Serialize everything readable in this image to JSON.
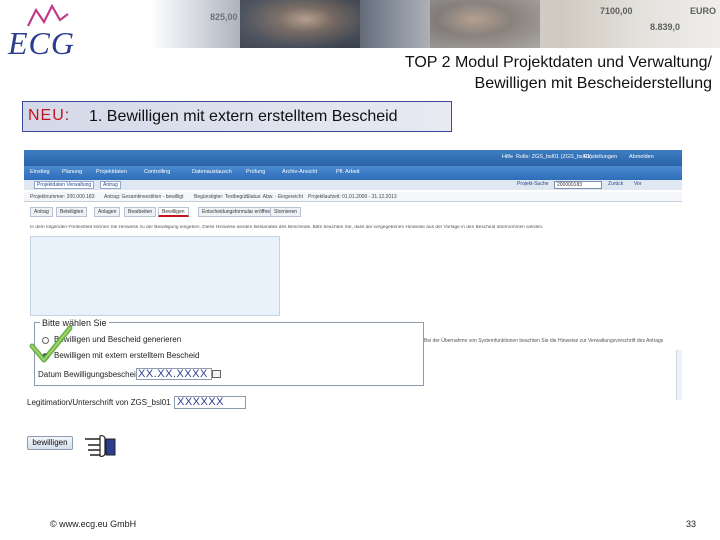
{
  "slide": {
    "title_line1": "TOP 2 Modul Projektdaten und Verwaltung/",
    "title_line2": "Bewilligen mit Bescheiderstellung",
    "neu_label": "NEU:",
    "neu_text": "1. Bewilligen mit extern erstelltem Bescheid",
    "footer_copyright": "© www.ecg.eu GmbH",
    "page_number": "33"
  },
  "logo": {
    "text": "ECG",
    "color": "#2a3d8f"
  },
  "banner": {
    "notes": [
      "825,00",
      "7100,00",
      "8.839,0",
      "EURO"
    ]
  },
  "app": {
    "nav_items": [
      "Einstieg",
      "Planung",
      "Projektdaten",
      "Controlling",
      "Datenaustausch",
      "Prüfung",
      "Archiv-Ansicht",
      "Pfl. Arbeit"
    ],
    "user_area": [
      "Hilfe",
      "Rolle: ZGS_bsl01 (ZGS_bsl01)",
      "Einstellungen",
      "Abmelden"
    ],
    "crumbs": [
      "Projektdaten Verwaltung",
      "Antrag"
    ],
    "search_label": "Projekt-Suche",
    "search_value": "200000183",
    "back_link": "Zurück",
    "forward_link": "Vor",
    "info_items": [
      "Projektnummer: 200.000.183",
      "Antrag: Gesamtinvestition - bewilligt",
      "Begünstigter: Testbegün",
      "Status: Abw. - Eingereicht",
      "Projektlaufzeit: 01.01.2009 - 31.12.2013"
    ],
    "tabs": [
      "Antrag",
      "Beteiligten",
      "Anlagen",
      "Bearbeiten",
      "Bewilligen",
      "Entscheidungsformular eröffnen",
      "Stornieren"
    ],
    "active_tab_index": 4,
    "description": "In dem folgenden Freitextfeld können Sie Hinweise zu der Bewilligung eingeben. Diese Hinweise werden Bestandteil des Bescheids. Bitte beachten Sie, dass die vorgegebenen Hinweise aus der Vorlage in den Bescheid übernommen werden.",
    "right_note": "Bei der Übernahme von Systemfunktionen beachten Sie die Hinweise zur Verwaltungsvorschrift des Antrags",
    "legend": "Bitte wählen Sie",
    "options": [
      {
        "label": "Bewilligen und Bescheid generieren",
        "selected": false
      },
      {
        "label": "Bewilligen mit extern erstelltem Bescheid",
        "selected": true
      }
    ],
    "date_label": "Datum Bewilligungsbescheid",
    "date_value": "XX.XX.XXXX",
    "sign_label": "Legitimation/Unterschrift von ZGS_bsl01",
    "sign_value": "XXXXXX",
    "approve_button": "bewilligen",
    "accent_color": "#c2141e",
    "bar_color": "#2e6db8"
  }
}
